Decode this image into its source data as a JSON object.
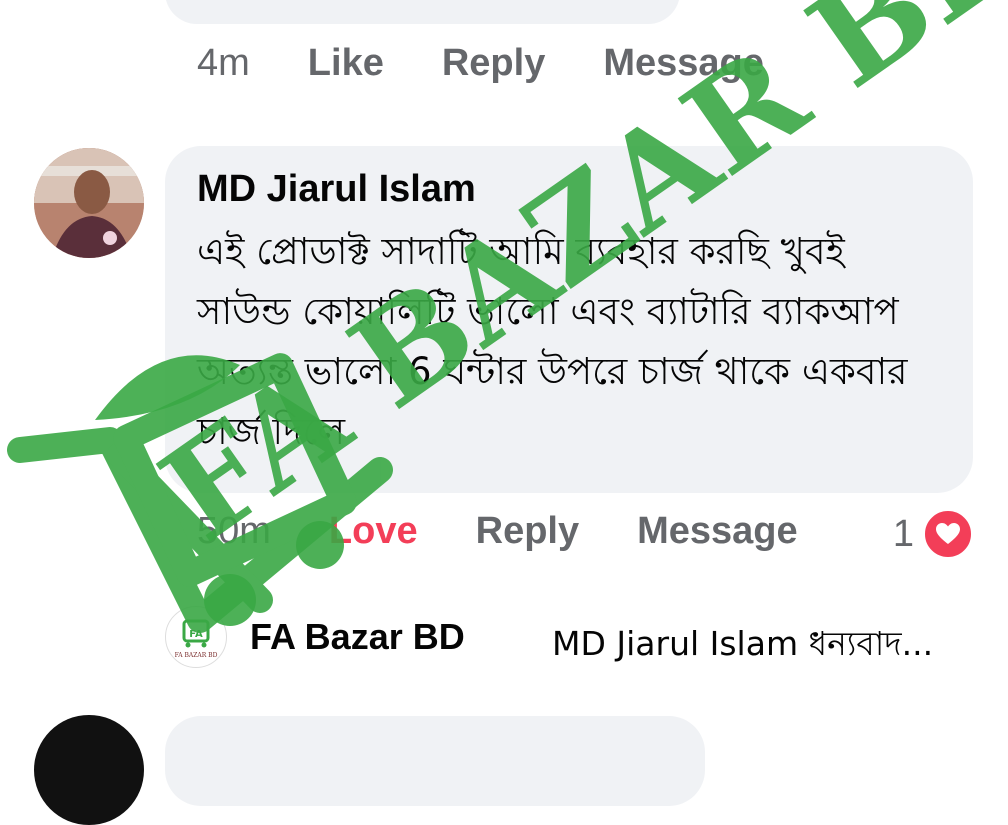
{
  "previous_comment": {
    "time": "4m",
    "like_label": "Like",
    "reply_label": "Reply",
    "message_label": "Message"
  },
  "comment": {
    "author": "MD Jiarul Islam",
    "text": "এই প্রোডাক্ট সাদাটি আমি ব্যবহার করছি খুবই সাউন্ড কোয়ালিটি ভালো এবং ব্যাটারি ব্যাকআপ অত্যন্ত ভালো 6 ঘন্টার উপরে চার্জ থাকে একবার চার্জ দিলে",
    "time": "50m",
    "reaction_label": "Love",
    "reply_label": "Reply",
    "message_label": "Message",
    "reaction_count": "1",
    "reaction_icon": "heart-icon"
  },
  "reply": {
    "author": "FA Bazar BD",
    "preview": "MD Jiarul Islam ধন্যবাদ...",
    "avatar_logo_text": "FA BAZAR BD"
  },
  "watermark": {
    "text": "FA BAZAR BD",
    "color": "#3aa845"
  },
  "colors": {
    "bubble": "#f0f2f5",
    "secondary_text": "#65676b",
    "love": "#f33e58"
  }
}
